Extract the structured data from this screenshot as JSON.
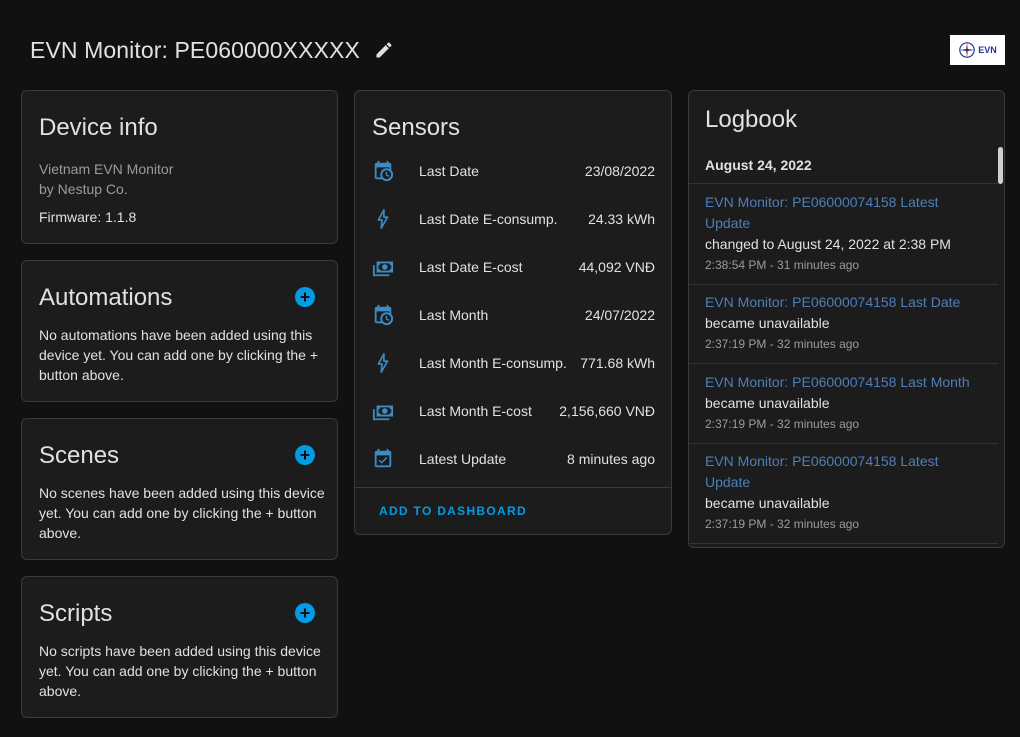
{
  "header": {
    "title": "EVN Monitor: PE060000XXXXX",
    "logo_text": "EVN"
  },
  "device_info": {
    "title": "Device info",
    "model": "Vietnam EVN Monitor",
    "manufacturer": "by Nestup Co.",
    "firmware": "Firmware: 1.1.8"
  },
  "automations": {
    "title": "Automations",
    "message": "No automations have been added using this device yet. You can add one by clicking the + button above."
  },
  "scenes": {
    "title": "Scenes",
    "message": "No scenes have been added using this device yet. You can add one by clicking the + button above."
  },
  "scripts": {
    "title": "Scripts",
    "message": "No scripts have been added using this device yet. You can add one by clicking the + button above."
  },
  "sensors": {
    "title": "Sensors",
    "items": [
      {
        "icon": "calendar-clock-icon",
        "name": "Last Date",
        "value": "23/08/2022"
      },
      {
        "icon": "lightning-bolt-icon",
        "name": "Last Date E-consump.",
        "value": "24.33 kWh"
      },
      {
        "icon": "cash-multiple-icon",
        "name": "Last Date E-cost",
        "value": "44,092 VNĐ"
      },
      {
        "icon": "calendar-clock-icon",
        "name": "Last Month",
        "value": "24/07/2022"
      },
      {
        "icon": "lightning-bolt-icon",
        "name": "Last Month E-consump.",
        "value": "771.68 kWh"
      },
      {
        "icon": "cash-multiple-icon",
        "name": "Last Month E-cost",
        "value": "2,156,660 VNĐ"
      },
      {
        "icon": "calendar-check-icon",
        "name": "Latest Update",
        "value": "8 minutes ago"
      }
    ],
    "add_to_dashboard": "ADD TO DASHBOARD"
  },
  "logbook": {
    "title": "Logbook",
    "date_header": "August 24, 2022",
    "entries": [
      {
        "entity": "EVN Monitor: PE06000074158 Latest Update",
        "message": "changed to August 24, 2022 at 2:38 PM",
        "time": "2:38:54 PM - 31 minutes ago"
      },
      {
        "entity": "EVN Monitor: PE06000074158 Last Date",
        "message": "became unavailable",
        "time": "2:37:19 PM - 32 minutes ago"
      },
      {
        "entity": "EVN Monitor: PE06000074158 Last Month",
        "message": "became unavailable",
        "time": "2:37:19 PM - 32 minutes ago"
      },
      {
        "entity": "EVN Monitor: PE06000074158 Latest Update",
        "message": "became unavailable",
        "time": "2:37:19 PM - 32 minutes ago"
      }
    ]
  },
  "colors": {
    "accent": "#039be5",
    "link": "#4f7fb7",
    "background": "#111111",
    "card": "#1c1c1c",
    "icon": "#3c8bc4"
  }
}
